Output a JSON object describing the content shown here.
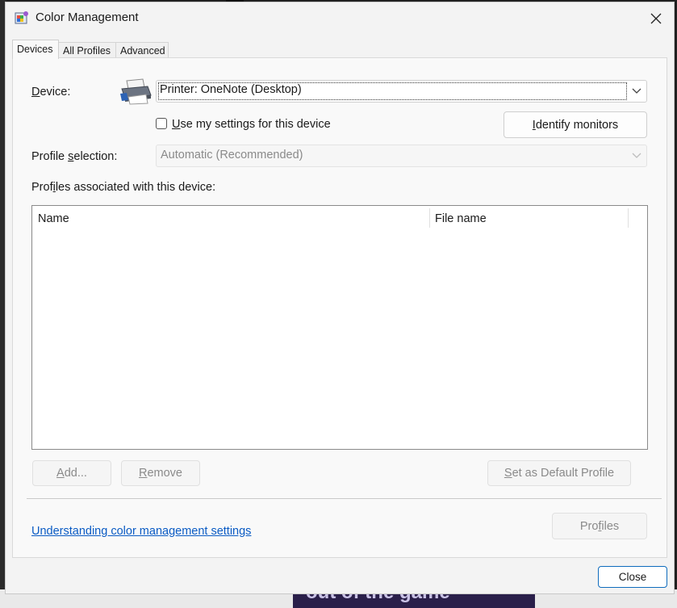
{
  "window": {
    "title": "Color Management"
  },
  "tabs": [
    {
      "label": "Devices",
      "active": true
    },
    {
      "label": "All Profiles",
      "active": false
    },
    {
      "label": "Advanced",
      "active": false
    }
  ],
  "device": {
    "label_pre": "",
    "label_hot": "D",
    "label_post": "evice:",
    "value": "Printer: OneNote (Desktop)",
    "icon": "printer-icon"
  },
  "use_settings": {
    "label_hot": "U",
    "label_post": "se my settings for this device",
    "checked": false
  },
  "identify_monitors": {
    "label_hot": "I",
    "label_post": "dentify monitors"
  },
  "profile_selection": {
    "label_pre": "Profile ",
    "label_hot": "s",
    "label_post": "election:",
    "value": "Automatic (Recommended)"
  },
  "profiles_associated": {
    "label_pre": "Prof",
    "label_hot": "i",
    "label_post": "les associated with this device:"
  },
  "list_columns": [
    "Name",
    "File name"
  ],
  "buttons": {
    "add": {
      "hot": "A",
      "post": "dd..."
    },
    "remove": {
      "hot": "R",
      "post": "emove"
    },
    "set_default": {
      "hot": "S",
      "post": "et as Default Profile"
    },
    "profiles": {
      "pre": "Pro",
      "hot": "f",
      "post": "iles"
    },
    "close": "Close"
  },
  "link": "Understanding color management settings",
  "background": {
    "banner_text": "out of the game"
  },
  "colors": {
    "accent": "#0f6cbd",
    "link": "#0a5bc4",
    "window_bg": "#f3f3f3"
  }
}
